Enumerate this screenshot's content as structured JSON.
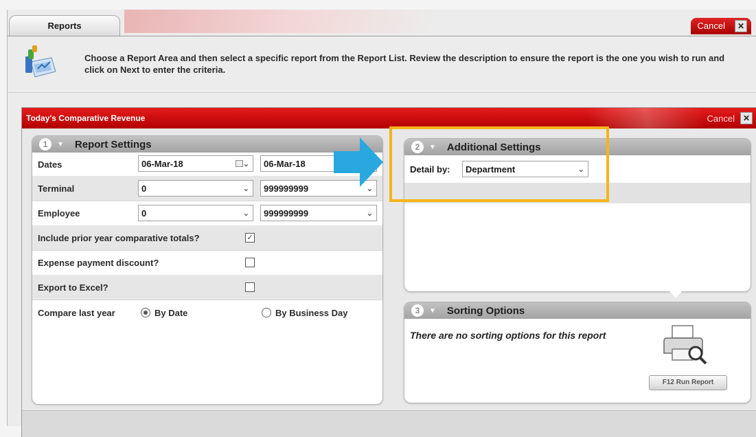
{
  "outer": {
    "tab_label": "Reports",
    "cancel_label": "Cancel",
    "close_glyph": "✕",
    "instructions": "Choose a Report Area and then select a specific report from the Report List. Review the description to ensure the report is the one you wish to run and click on Next to enter the criteria.",
    "report_icon": "reports-icon"
  },
  "dialog": {
    "title": "Today's Comparative Revenue",
    "cancel_label": "Cancel",
    "close_glyph": "✕",
    "accent_color": "#d00000"
  },
  "report_settings": {
    "number": "1",
    "title": "Report Settings",
    "rows": {
      "dates": {
        "label": "Dates",
        "from": "06-Mar-18",
        "to": "06-Mar-18"
      },
      "terminal": {
        "label": "Terminal",
        "from": "0",
        "to": "999999999"
      },
      "employee": {
        "label": "Employee",
        "from": "0",
        "to": "999999999"
      },
      "prior_year": {
        "label": "Include prior year comparative totals?",
        "checked": true,
        "check_glyph": "✓"
      },
      "expense_discount": {
        "label": "Expense payment discount?",
        "checked": false
      },
      "export_excel": {
        "label": "Export to Excel?",
        "checked": false
      },
      "compare_last_year": {
        "label": "Compare last year",
        "option_by_date": "By Date",
        "option_by_business_day": "By Business Day",
        "selected": "By Date"
      }
    }
  },
  "additional_settings": {
    "number": "2",
    "title": "Additional Settings",
    "detail_by_label": "Detail by:",
    "detail_by_value": "Department",
    "highlight_color": "#f6b41a",
    "arrow_color": "#29a8e0"
  },
  "sorting_options": {
    "number": "3",
    "title": "Sorting Options",
    "empty_message": "There are no sorting options for this report",
    "run_button_label": "F12  Run Report",
    "printer_icon": "printer-icon"
  },
  "glyphs": {
    "caret": "▼",
    "dropdown": "⌄"
  }
}
